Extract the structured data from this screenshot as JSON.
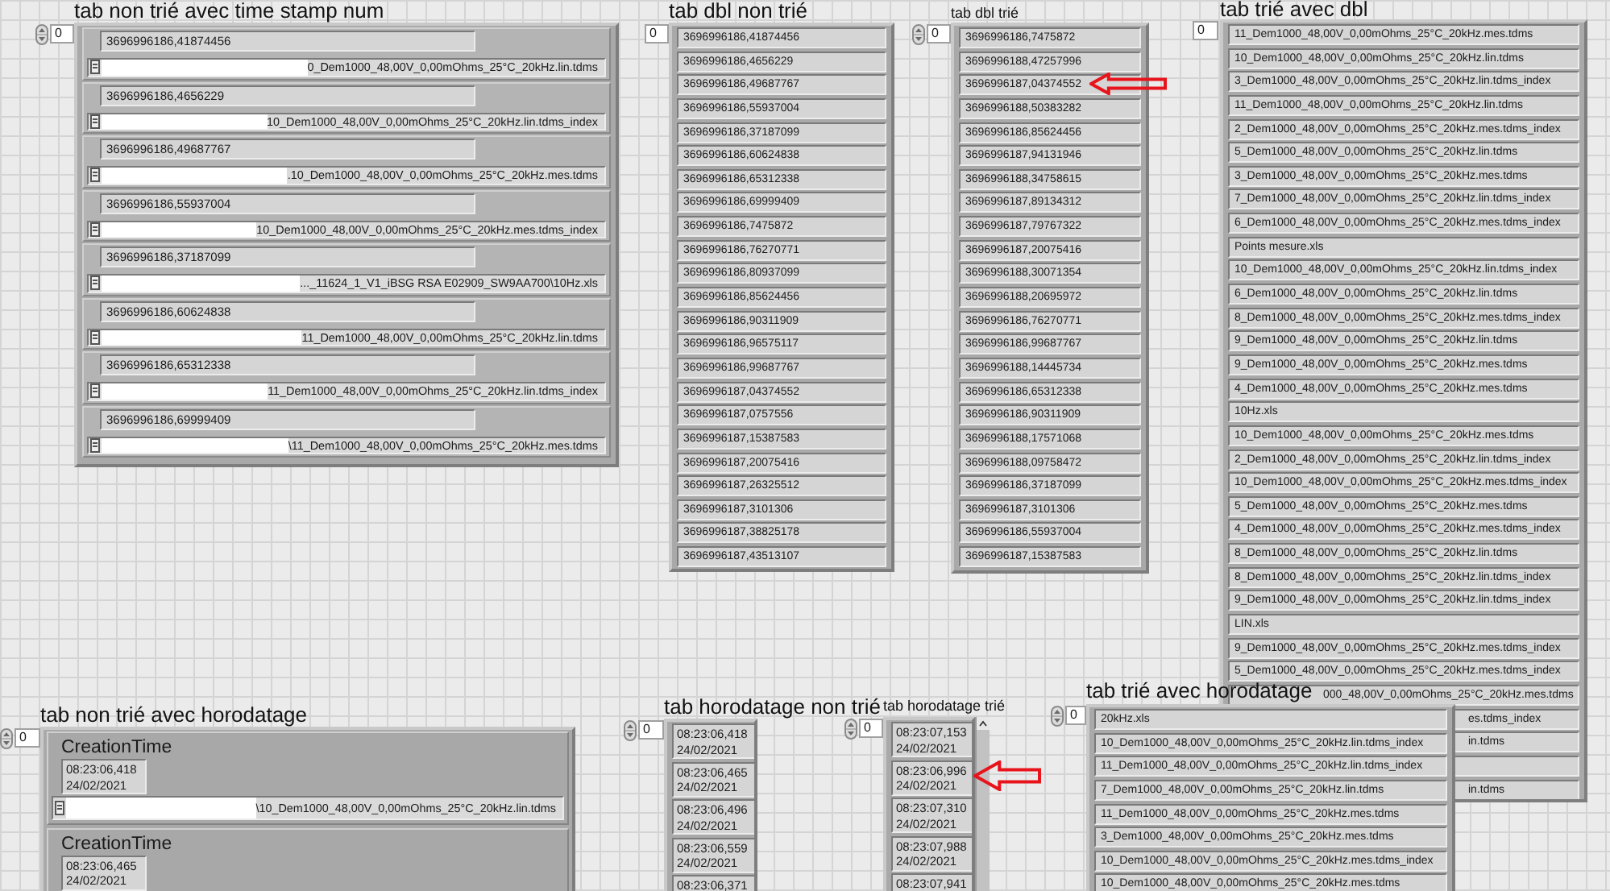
{
  "panels": [
    {
      "kind": "cluster_array",
      "label": "tab non trié avec time stamp num",
      "index": "0",
      "items": [
        {
          "number": "3696996186,41874456",
          "path": "0_Dem1000_48,00V_0,00mOhms_25°C_20kHz.lin.tdms",
          "redacted": true
        },
        {
          "number": "3696996186,4656229",
          "path": "10_Dem1000_48,00V_0,00mOhms_25°C_20kHz.lin.tdms_index",
          "redacted": true
        },
        {
          "number": "3696996186,49687767",
          "path": ".10_Dem1000_48,00V_0,00mOhms_25°C_20kHz.mes.tdms",
          "redacted": true
        },
        {
          "number": "3696996186,55937004",
          "path": "10_Dem1000_48,00V_0,00mOhms_25°C_20kHz.mes.tdms_index",
          "redacted": true
        },
        {
          "number": "3696996186,37187099",
          "path": "..._11624_1_V1_iBSG RSA E02909_SW9AA700\\10Hz.xls",
          "redacted": true
        },
        {
          "number": "3696996186,60624838",
          "path": "11_Dem1000_48,00V_0,00mOhms_25°C_20kHz.lin.tdms",
          "redacted": true
        },
        {
          "number": "3696996186,65312338",
          "path": "11_Dem1000_48,00V_0,00mOhms_25°C_20kHz.lin.tdms_index",
          "redacted": true
        },
        {
          "number": "3696996186,69999409",
          "path": "\\11_Dem1000_48,00V_0,00mOhms_25°C_20kHz.mes.tdms",
          "redacted": true
        }
      ]
    },
    {
      "kind": "string_array",
      "label": "tab dbl non trié",
      "index": "0",
      "items": [
        {
          "text": "3696996186,41874456"
        },
        {
          "text": "3696996186,4656229"
        },
        {
          "text": "3696996186,49687767"
        },
        {
          "text": "3696996186,55937004"
        },
        {
          "text": "3696996186,37187099"
        },
        {
          "text": "3696996186,60624838"
        },
        {
          "text": "3696996186,65312338"
        },
        {
          "text": "3696996186,69999409"
        },
        {
          "text": "3696996186,7475872"
        },
        {
          "text": "3696996186,76270771"
        },
        {
          "text": "3696996186,80937099"
        },
        {
          "text": "3696996186,85624456"
        },
        {
          "text": "3696996186,90311909"
        },
        {
          "text": "3696996186,96575117"
        },
        {
          "text": "3696996186,99687767"
        },
        {
          "text": "3696996187,04374552"
        },
        {
          "text": "3696996187,0757556"
        },
        {
          "text": "3696996187,15387583"
        },
        {
          "text": "3696996187,20075416"
        },
        {
          "text": "3696996187,26325512"
        },
        {
          "text": "3696996187,3101306"
        },
        {
          "text": "3696996187,38825178"
        },
        {
          "text": "3696996187,43513107"
        }
      ]
    },
    {
      "kind": "string_array",
      "label": "tab dbl trié",
      "index": "0",
      "items": [
        {
          "text": "3696996186,7475872"
        },
        {
          "text": "3696996188,47257996"
        },
        {
          "text": "3696996187,04374552"
        },
        {
          "text": "3696996188,50383282"
        },
        {
          "text": "3696996186,85624456"
        },
        {
          "text": "3696996187,94131946"
        },
        {
          "text": "3696996188,34758615"
        },
        {
          "text": "3696996187,89134312"
        },
        {
          "text": "3696996187,79767322"
        },
        {
          "text": "3696996187,20075416"
        },
        {
          "text": "3696996188,30071354"
        },
        {
          "text": "3696996188,20695972"
        },
        {
          "text": "3696996186,76270771"
        },
        {
          "text": "3696996186,99687767"
        },
        {
          "text": "3696996188,14445734"
        },
        {
          "text": "3696996186,65312338"
        },
        {
          "text": "3696996186,90311909"
        },
        {
          "text": "3696996188,17571068"
        },
        {
          "text": "3696996188,09758472"
        },
        {
          "text": "3696996186,37187099"
        },
        {
          "text": "3696996187,3101306"
        },
        {
          "text": "3696996186,55937004"
        },
        {
          "text": "3696996187,15387583"
        }
      ]
    },
    {
      "kind": "string_array",
      "label": "tab trié avec dbl",
      "index": "0",
      "items": [
        {
          "kind": "full",
          "text": "11_Dem1000_48,00V_0,00mOhms_25°C_20kHz.mes.tdms"
        },
        {
          "kind": "full",
          "text": "10_Dem1000_48,00V_0,00mOhms_25°C_20kHz.lin.tdms"
        },
        {
          "kind": "full",
          "text": "3_Dem1000_48,00V_0,00mOhms_25°C_20kHz.lin.tdms_index"
        },
        {
          "kind": "full",
          "text": "11_Dem1000_48,00V_0,00mOhms_25°C_20kHz.lin.tdms"
        },
        {
          "kind": "full",
          "text": "2_Dem1000_48,00V_0,00mOhms_25°C_20kHz.mes.tdms_index"
        },
        {
          "kind": "full",
          "text": "5_Dem1000_48,00V_0,00mOhms_25°C_20kHz.lin.tdms"
        },
        {
          "kind": "full",
          "text": "3_Dem1000_48,00V_0,00mOhms_25°C_20kHz.mes.tdms"
        },
        {
          "kind": "full",
          "text": "7_Dem1000_48,00V_0,00mOhms_25°C_20kHz.lin.tdms_index"
        },
        {
          "kind": "full",
          "text": "6_Dem1000_48,00V_0,00mOhms_25°C_20kHz.mes.tdms_index"
        },
        {
          "kind": "full",
          "text": "Points mesure.xls"
        },
        {
          "kind": "full",
          "text": "10_Dem1000_48,00V_0,00mOhms_25°C_20kHz.lin.tdms_index"
        },
        {
          "kind": "full",
          "text": "6_Dem1000_48,00V_0,00mOhms_25°C_20kHz.lin.tdms"
        },
        {
          "kind": "full",
          "text": "8_Dem1000_48,00V_0,00mOhms_25°C_20kHz.mes.tdms_index"
        },
        {
          "kind": "full",
          "text": "9_Dem1000_48,00V_0,00mOhms_25°C_20kHz.lin.tdms"
        },
        {
          "kind": "full",
          "text": "9_Dem1000_48,00V_0,00mOhms_25°C_20kHz.mes.tdms"
        },
        {
          "kind": "full",
          "text": "4_Dem1000_48,00V_0,00mOhms_25°C_20kHz.mes.tdms"
        },
        {
          "kind": "full",
          "text": "10Hz.xls"
        },
        {
          "kind": "full",
          "text": "10_Dem1000_48,00V_0,00mOhms_25°C_20kHz.mes.tdms"
        },
        {
          "kind": "full",
          "text": "2_Dem1000_48,00V_0,00mOhms_25°C_20kHz.lin.tdms_index"
        },
        {
          "kind": "full",
          "text": "10_Dem1000_48,00V_0,00mOhms_25°C_20kHz.mes.tdms_index"
        },
        {
          "kind": "full",
          "text": "5_Dem1000_48,00V_0,00mOhms_25°C_20kHz.mes.tdms"
        },
        {
          "kind": "full",
          "text": "4_Dem1000_48,00V_0,00mOhms_25°C_20kHz.mes.tdms_index"
        },
        {
          "kind": "full",
          "text": "8_Dem1000_48,00V_0,00mOhms_25°C_20kHz.lin.tdms"
        },
        {
          "kind": "full",
          "text": "8_Dem1000_48,00V_0,00mOhms_25°C_20kHz.lin.tdms_index"
        },
        {
          "kind": "full",
          "text": "9_Dem1000_48,00V_0,00mOhms_25°C_20kHz.lin.tdms_index"
        },
        {
          "kind": "full",
          "text": "LIN.xls"
        },
        {
          "kind": "full",
          "text": "9_Dem1000_48,00V_0,00mOhms_25°C_20kHz.mes.tdms_index"
        },
        {
          "kind": "full",
          "text": "5_Dem1000_48,00V_0,00mOhms_25°C_20kHz.mes.tdms_index"
        },
        {
          "kind": "overlapped",
          "text": "000_48,00V_0,00mOhms_25°C_20kHz.mes.tdms"
        },
        {
          "kind": "hidden",
          "text": "es.tdms_index"
        },
        {
          "kind": "hidden",
          "text": "in.tdms"
        },
        {
          "kind": "hidden"
        },
        {
          "kind": "hidden",
          "text": "in.tdms"
        }
      ]
    },
    {
      "kind": "time_cluster_array",
      "label": "tab non trié avec horodatage",
      "index": "0",
      "items": [
        {
          "field_label": "CreationTime",
          "time": "08:23:06,418",
          "date": "24/02/2021",
          "path": "\\10_Dem1000_48,00V_0,00mOhms_25°C_20kHz.lin.tdms",
          "redacted": true
        },
        {
          "field_label": "CreationTime",
          "time": "08:23:06,465",
          "date": "24/02/2021"
        }
      ]
    },
    {
      "kind": "time_array",
      "label": "tab horodatage non trié",
      "index": "0",
      "items": [
        {
          "time": "08:23:06,418",
          "date": "24/02/2021"
        },
        {
          "time": "08:23:06,465",
          "date": "24/02/2021"
        },
        {
          "time": "08:23:06,496",
          "date": "24/02/2021"
        },
        {
          "time": "08:23:06,559",
          "date": "24/02/2021"
        },
        {
          "time": "08:23:06,371"
        }
      ]
    },
    {
      "kind": "time_array",
      "label": "tab horodatage trié",
      "index": "0",
      "items": [
        {
          "time": "08:23:07,153",
          "date": "24/02/2021"
        },
        {
          "time": "08:23:06,996",
          "date": "24/02/2021"
        },
        {
          "time": "08:23:07,310",
          "date": "24/02/2021"
        },
        {
          "time": "08:23:07,988",
          "date": "24/02/2021"
        },
        {
          "time": "08:23:07,941"
        }
      ]
    },
    {
      "kind": "string_array",
      "label": "tab trié  avec horodatage",
      "index": "0",
      "items": [
        {
          "text": "20kHz.xls"
        },
        {
          "text": "10_Dem1000_48,00V_0,00mOhms_25°C_20kHz.lin.tdms_index"
        },
        {
          "text": "11_Dem1000_48,00V_0,00mOhms_25°C_20kHz.lin.tdms_index"
        },
        {
          "text": "7_Dem1000_48,00V_0,00mOhms_25°C_20kHz.lin.tdms"
        },
        {
          "text": "11_Dem1000_48,00V_0,00mOhms_25°C_20kHz.mes.tdms"
        },
        {
          "text": "3_Dem1000_48,00V_0,00mOhms_25°C_20kHz.mes.tdms"
        },
        {
          "text": "10_Dem1000_48,00V_0,00mOhms_25°C_20kHz.mes.tdms_index"
        },
        {
          "text": "10_Dem1000_48,00V_0,00mOhms_25°C_20kHz.mes.tdms"
        }
      ]
    }
  ]
}
